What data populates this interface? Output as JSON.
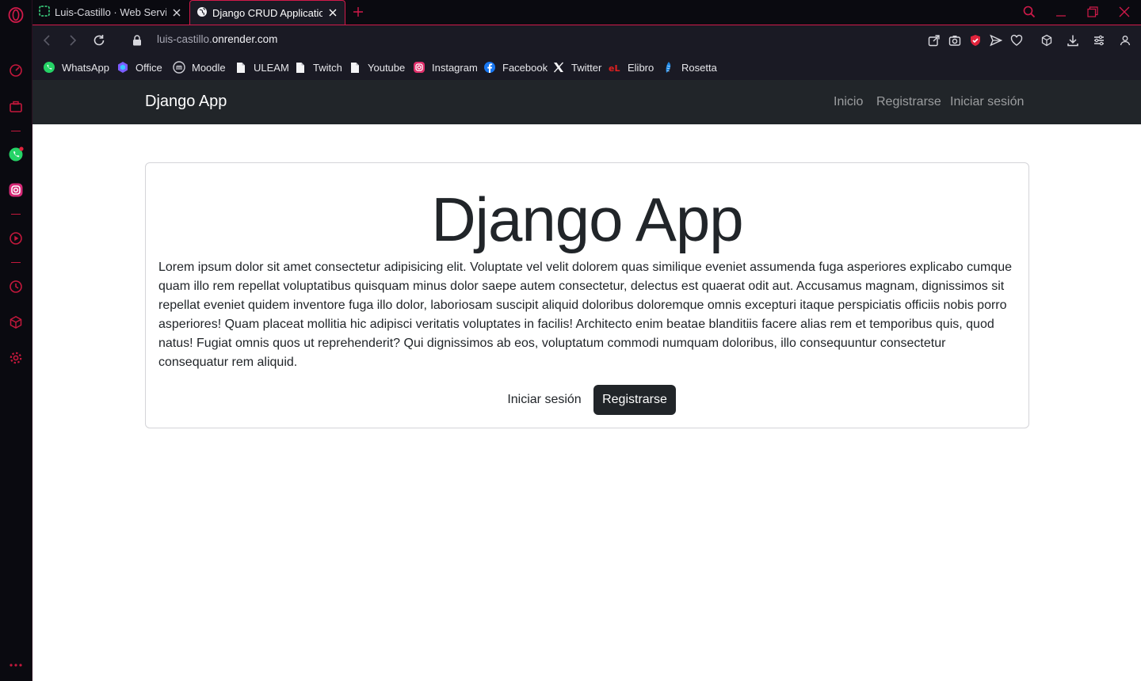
{
  "browser": {
    "tabs": [
      {
        "title": "Luis-Castillo · Web Service",
        "active": false,
        "icon": "render-icon"
      },
      {
        "title": "Django CRUD Application",
        "active": true,
        "icon": "globe-icon"
      }
    ],
    "address": {
      "url_prefix": "luis-castillo.",
      "url_domain": "onrender.com"
    },
    "bookmarks": [
      {
        "label": "WhatsApp",
        "icon": "whatsapp-icon",
        "color": "#25D366"
      },
      {
        "label": "Office",
        "icon": "office-icon",
        "color": "#7b5cff"
      },
      {
        "label": "Moodle",
        "icon": "moodle-icon",
        "color": "#cfcfd6"
      },
      {
        "label": "ULEAM",
        "icon": "page-icon",
        "color": "#ffffff"
      },
      {
        "label": "Twitch",
        "icon": "page-icon",
        "color": "#ffffff"
      },
      {
        "label": "Youtube",
        "icon": "page-icon",
        "color": "#ffffff"
      },
      {
        "label": "Instagram",
        "icon": "instagram-icon",
        "color": "#e1306c"
      },
      {
        "label": "Facebook",
        "icon": "facebook-icon",
        "color": "#1877f2"
      },
      {
        "label": "Twitter",
        "icon": "x-icon",
        "color": "#ffffff"
      },
      {
        "label": "Elibro",
        "icon": "elibro-icon",
        "color": "#e02020"
      },
      {
        "label": "Rosetta",
        "icon": "rosetta-icon",
        "color": "#1e88e5"
      }
    ],
    "accent": "#d11a4a"
  },
  "site": {
    "brand": "Django App",
    "nav": {
      "home": "Inicio",
      "register": "Registrarse",
      "login": "Iniciar sesión"
    },
    "hero": {
      "title": "Django App",
      "body": "Lorem ipsum dolor sit amet consectetur adipisicing elit. Voluptate vel velit dolorem quas similique eveniet assumenda fuga asperiores explicabo cumque quam illo rem repellat voluptatibus quisquam minus dolor saepe autem consectetur, delectus est quaerat odit aut. Accusamus magnam, dignissimos sit repellat eveniet quidem inventore fuga illo dolor, laboriosam suscipit aliquid doloribus doloremque omnis excepturi itaque perspiciatis officiis nobis porro asperiores! Quam placeat mollitia hic adipisci veritatis voluptates in facilis! Architecto enim beatae blanditiis facere alias rem et temporibus quis, quod natus! Fugiat omnis quos ut reprehenderit? Qui dignissimos ab eos, voluptatum commodi numquam doloribus, illo consequuntur consectetur consequatur rem aliquid.",
      "login_button": "Iniciar sesión",
      "register_button": "Registrarse"
    },
    "colors": {
      "navbar": "#212529",
      "text": "#212529"
    }
  }
}
